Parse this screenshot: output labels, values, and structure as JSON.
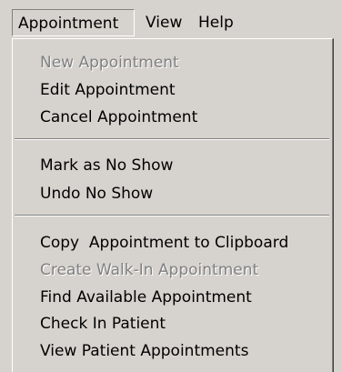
{
  "menubar": {
    "items": [
      {
        "label": "Appointment"
      },
      {
        "label": "View"
      },
      {
        "label": "Help"
      }
    ]
  },
  "dropdown": {
    "items": [
      {
        "label": "New Appointment",
        "enabled": false
      },
      {
        "label": "Edit Appointment",
        "enabled": true
      },
      {
        "label": "Cancel Appointment",
        "enabled": true
      },
      {
        "label": "Mark as No Show",
        "enabled": true
      },
      {
        "label": "Undo No Show",
        "enabled": true
      },
      {
        "label": "Copy  Appointment to Clipboard",
        "enabled": true
      },
      {
        "label": "Create Walk-In Appointment",
        "enabled": false
      },
      {
        "label": "Find Available Appointment",
        "enabled": true
      },
      {
        "label": "Check In Patient",
        "enabled": true
      },
      {
        "label": "View Patient Appointments",
        "enabled": true
      }
    ]
  },
  "colors": {
    "face": "#d6d3ce",
    "disabled_text": "#808080",
    "text": "#000000"
  }
}
